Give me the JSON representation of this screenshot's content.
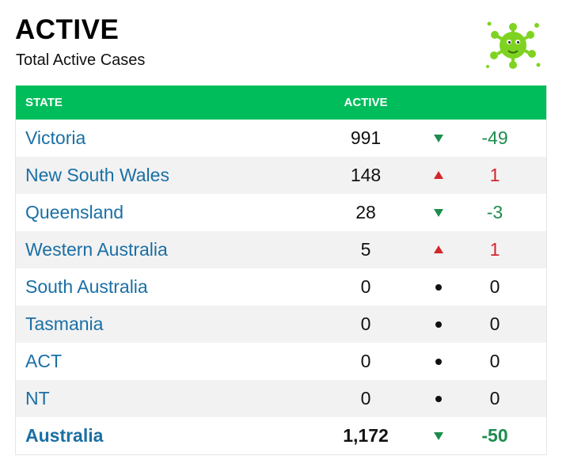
{
  "header": {
    "title": "ACTIVE",
    "subtitle": "Total Active Cases",
    "icon": "virus-icon"
  },
  "table": {
    "columns": [
      "STATE",
      "ACTIVE"
    ],
    "header_color": "#00bd5c",
    "rows": [
      {
        "state": "Victoria",
        "active": "991",
        "trend": "down",
        "change": "-49"
      },
      {
        "state": "New South Wales",
        "active": "148",
        "trend": "up",
        "change": "1"
      },
      {
        "state": "Queensland",
        "active": "28",
        "trend": "down",
        "change": "-3"
      },
      {
        "state": "Western Australia",
        "active": "5",
        "trend": "up",
        "change": "1"
      },
      {
        "state": "South Australia",
        "active": "0",
        "trend": "flat",
        "change": "0"
      },
      {
        "state": "Tasmania",
        "active": "0",
        "trend": "flat",
        "change": "0"
      },
      {
        "state": "ACT",
        "active": "0",
        "trend": "flat",
        "change": "0"
      },
      {
        "state": "NT",
        "active": "0",
        "trend": "flat",
        "change": "0"
      }
    ],
    "total": {
      "state": "Australia",
      "active": "1,172",
      "trend": "down",
      "change": "-50"
    }
  },
  "colors": {
    "link": "#1a6fa5",
    "down": "#1e8c4e",
    "up": "#d2262c"
  }
}
